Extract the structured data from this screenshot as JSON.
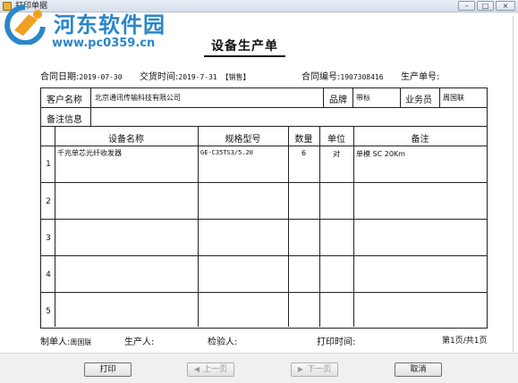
{
  "window": {
    "title": "打印单据",
    "minimize_label": "–",
    "maximize_label": "□",
    "close_label": "×"
  },
  "watermark": {
    "title": "河东软件园",
    "url": "www.pc0359.cn"
  },
  "document": {
    "title": "设备生产单",
    "contract_date_label": "合同日期:",
    "contract_date_value": "2019-07-30",
    "delivery_time_label": "交货时间:",
    "delivery_time_value": "2019-7-31 【销售】",
    "contract_no_label": "合同编号:",
    "contract_no_value": "1907308416",
    "production_no_label": "生产单号:",
    "production_no_value": ""
  },
  "customer": {
    "name_label": "客户名称",
    "name_value": "北京通讯传输科技有限公司",
    "brand_label": "品牌",
    "brand_value": "带标",
    "salesperson_label": "业务员",
    "salesperson_value": "周国联",
    "remarks_label": "备注信息",
    "remarks_value": ""
  },
  "table": {
    "columns": [
      "设备名称",
      "规格型号",
      "数量",
      "单位",
      "备注"
    ],
    "rows": [
      {
        "num": "1",
        "name": "千兆单芯光纤收发器",
        "spec": "GE-C35TS3/5.20",
        "qty": "6",
        "unit": "对",
        "note": "单模 SC 20Km"
      },
      {
        "num": "2",
        "name": "",
        "spec": "",
        "qty": "",
        "unit": "",
        "note": ""
      },
      {
        "num": "3",
        "name": "",
        "spec": "",
        "qty": "",
        "unit": "",
        "note": ""
      },
      {
        "num": "4",
        "name": "",
        "spec": "",
        "qty": "",
        "unit": "",
        "note": ""
      },
      {
        "num": "5",
        "name": "",
        "spec": "",
        "qty": "",
        "unit": "",
        "note": ""
      }
    ]
  },
  "footer": {
    "maker_label": "制单人:",
    "maker_value": "周国联",
    "producer_label": "生产人:",
    "inspector_label": "检验人:",
    "print_time_label": "打印时间:",
    "page_info": "第1页/共1页"
  },
  "buttons": {
    "print": "打印",
    "prev": "上一页",
    "next": "下一页",
    "cancel": "取消"
  },
  "colors": {
    "watermark": "#2a86c8",
    "window_bg": "#f0f0f0"
  }
}
